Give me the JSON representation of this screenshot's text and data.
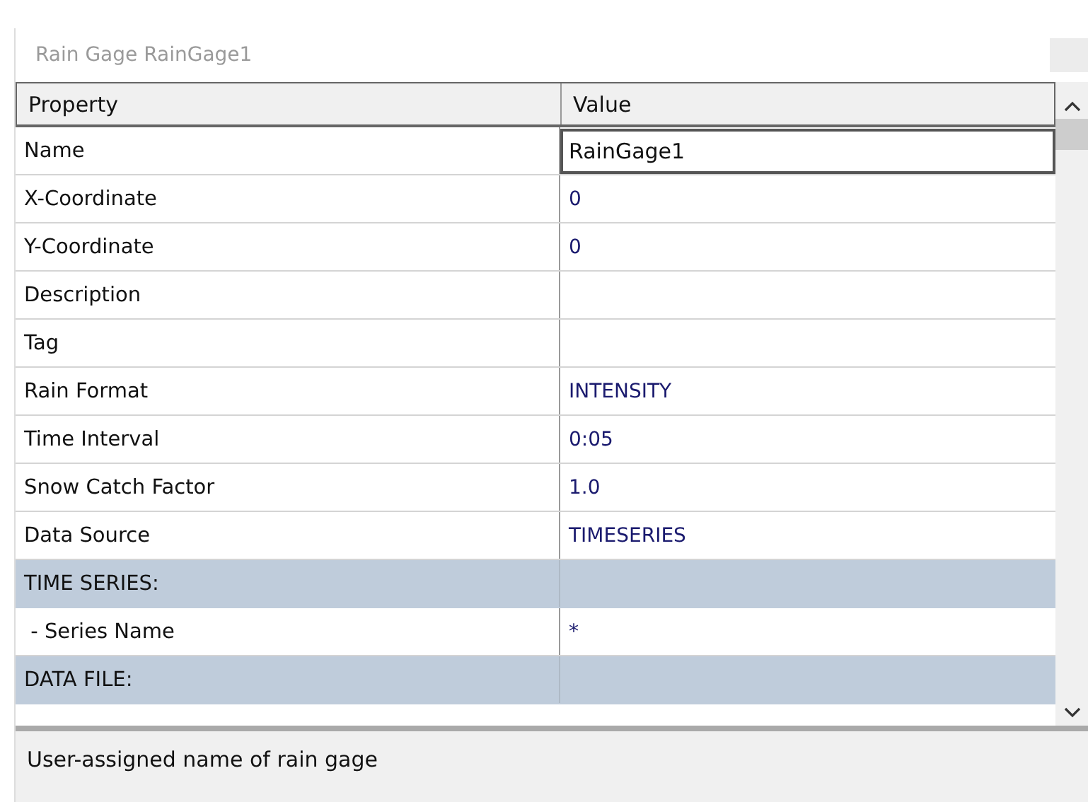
{
  "window": {
    "title": "Rain Gage RainGage1"
  },
  "table": {
    "columns": [
      "Property",
      "Value"
    ],
    "rows": [
      {
        "kind": "property",
        "property": "Name",
        "value": "RainGage1",
        "editing": true
      },
      {
        "kind": "property",
        "property": "X-Coordinate",
        "value": "0",
        "editing": false
      },
      {
        "kind": "property",
        "property": "Y-Coordinate",
        "value": "0",
        "editing": false
      },
      {
        "kind": "property",
        "property": "Description",
        "editing": false
      },
      {
        "kind": "property",
        "property": "Tag",
        "editing": false
      },
      {
        "kind": "property",
        "property": "Rain Format",
        "value": "INTENSITY",
        "editing": false
      },
      {
        "kind": "property",
        "property": "Time Interval",
        "value": "0:05",
        "editing": false
      },
      {
        "kind": "property",
        "property": "Snow Catch Factor",
        "value": "1.0",
        "editing": false
      },
      {
        "kind": "property",
        "property": "Data Source",
        "value": "TIMESERIES",
        "editing": false
      },
      {
        "kind": "section",
        "property": "TIME SERIES:"
      },
      {
        "kind": "property",
        "property": " - Series Name",
        "value": "*",
        "editing": false
      },
      {
        "kind": "section",
        "property": "DATA FILE:"
      }
    ]
  },
  "status_bar": {
    "text": "User-assigned name of rain gage"
  }
}
